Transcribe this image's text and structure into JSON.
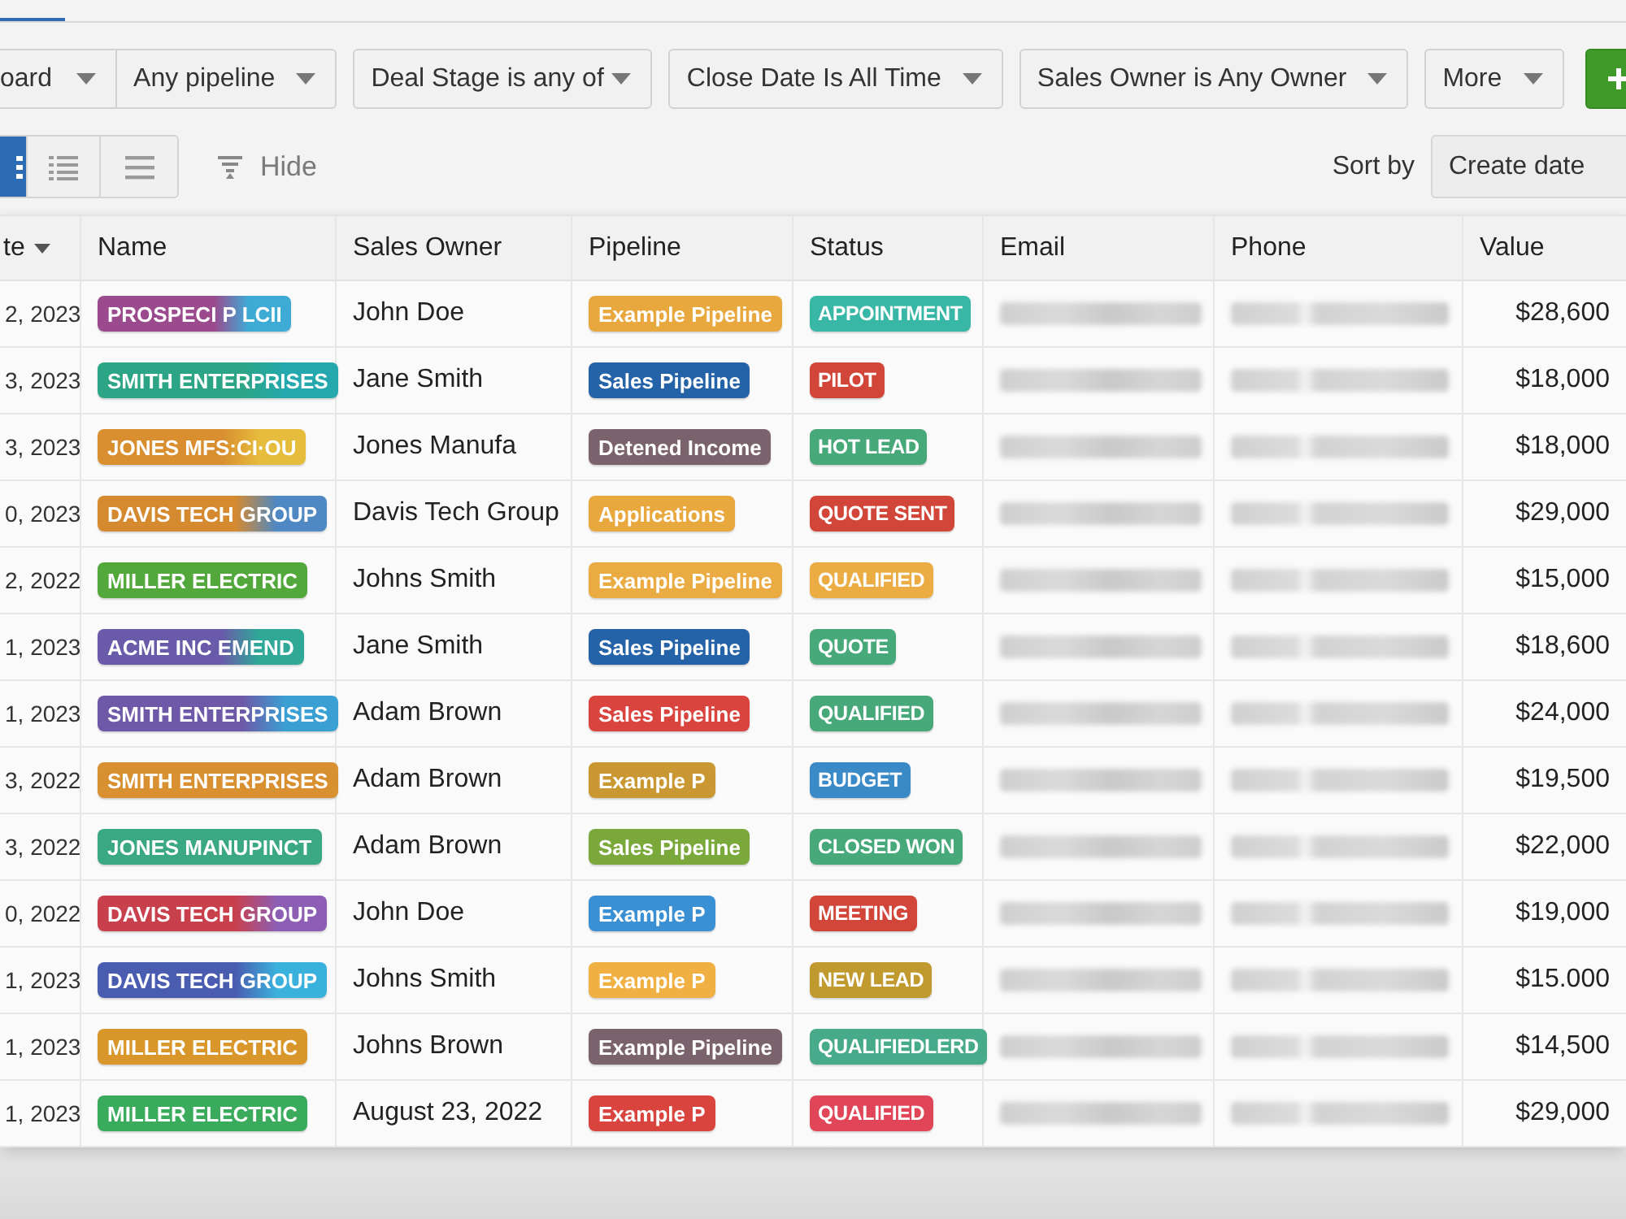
{
  "filters": [
    {
      "segments": [
        "oard",
        "Any pipeline"
      ]
    },
    {
      "segments": [
        "Deal Stage is any of"
      ]
    },
    {
      "segments": [
        "Close Date Is All Time"
      ]
    },
    {
      "segments": [
        "Sales Owner is Any Owner"
      ]
    },
    {
      "segments": [
        "More"
      ]
    }
  ],
  "view_modes": [
    {
      "kind": "grid",
      "selected": true
    },
    {
      "kind": "list",
      "selected": false
    },
    {
      "kind": "lines",
      "selected": false
    }
  ],
  "hide": {
    "label": "Hide"
  },
  "sort": {
    "label": "Sort by",
    "value": "Create date"
  },
  "table": {
    "columns": [
      {
        "label": "te",
        "sorted": true
      },
      {
        "label": "Name",
        "sorted": false
      },
      {
        "label": "Sales Owner",
        "sorted": false
      },
      {
        "label": "Pipeline",
        "sorted": false
      },
      {
        "label": "Status",
        "sorted": false
      },
      {
        "label": "Email",
        "sorted": false
      },
      {
        "label": "Phone",
        "sorted": false
      },
      {
        "label": "Value",
        "sorted": false
      }
    ],
    "rows": [
      {
        "date": "2, 2023",
        "name": {
          "text": "PROSPECI P LCII",
          "color": "#9b4a8e",
          "accent": {
            "color": "#3eaad6"
          }
        },
        "owner": "John Doe",
        "pipeline": {
          "text": "Example Pipeline",
          "color": "#e8a83e"
        },
        "status": {
          "text": "APPOINTMENT",
          "color": "#39b7a6"
        },
        "value": "$28,600"
      },
      {
        "date": "3, 2023",
        "name": {
          "text": "SMITH ENTERPRISES",
          "color": "#2ba585",
          "accent": {
            "color": "#25a8ad"
          }
        },
        "owner": "Jane Smith",
        "pipeline": {
          "text": "Sales Pipeline",
          "color": "#2563a8"
        },
        "status": {
          "text": "PILOT",
          "color": "#d2463a"
        },
        "value": "$18,000"
      },
      {
        "date": "3, 2023",
        "name": {
          "text": "JONES MFS:CI·OU",
          "color": "#d98f2f",
          "accent": {
            "color": "#e6bc3c"
          }
        },
        "owner": "Jones Manufa",
        "pipeline": {
          "text": "Detened Income",
          "color": "#7a636d"
        },
        "status": {
          "text": "HOT LEAD",
          "color": "#47a97a"
        },
        "value": "$18,000"
      },
      {
        "date": "0, 2023",
        "name": {
          "text": "DAVIS TECH GROUP",
          "color": "#d68a30",
          "accent": {
            "color": "#4f88c2"
          }
        },
        "owner": "Davis Tech Group",
        "pipeline": {
          "text": "Applications",
          "color": "#e8a83e"
        },
        "status": {
          "text": "QUOTE SENT",
          "color": "#d2463a"
        },
        "value": "$29,000"
      },
      {
        "date": "2, 2022",
        "name": {
          "text": "MILLER ELECTRIC",
          "color": "#52a83a"
        },
        "owner": "Johns Smith",
        "pipeline": {
          "text": "Example Pipeline",
          "color": "#e9ab42"
        },
        "status": {
          "text": "QUALIFIED",
          "color": "#ebad43"
        },
        "value": "$15,000"
      },
      {
        "date": "1, 2023",
        "name": {
          "text": "ACME INC EMEND",
          "color": "#6a5aaa",
          "accent": {
            "color": "#2fa898"
          }
        },
        "owner": "Jane Smith",
        "pipeline": {
          "text": "Sales Pipeline",
          "color": "#2563a8"
        },
        "status": {
          "text": "QUOTE",
          "color": "#47a97a"
        },
        "value": "$18,600"
      },
      {
        "date": "1, 2023",
        "name": {
          "text": "SMITH ENTERPRISES",
          "color": "#6e58a8",
          "accent": {
            "color": "#3a9fd2"
          }
        },
        "owner": "Adam Brown",
        "pipeline": {
          "text": "Sales Pipeline",
          "color": "#d9443f"
        },
        "status": {
          "text": "QUALIFIED",
          "color": "#47a97a"
        },
        "value": "$24,000"
      },
      {
        "date": "3, 2022",
        "name": {
          "text": "SMITH ENTERPRISES",
          "color": "#d99030"
        },
        "owner": "Adam Brown",
        "pipeline": {
          "text": "Example P",
          "color": "#c99832"
        },
        "status": {
          "text": "BUDGET",
          "color": "#3a8ac8"
        },
        "value": "$19,500"
      },
      {
        "date": "3, 2022",
        "name": {
          "text": "JONES MANUPINCT",
          "color": "#3aa882"
        },
        "owner": "Adam Brown",
        "pipeline": {
          "text": "Sales Pipeline",
          "color": "#7aa83a"
        },
        "status": {
          "text": "CLOSED WON",
          "color": "#47a97a"
        },
        "value": "$22,000"
      },
      {
        "date": "0, 2022",
        "name": {
          "text": "DAVIS TECH GROUP",
          "color": "#c9404d",
          "accent": {
            "color": "#8d5fb4"
          }
        },
        "owner": "John Doe",
        "pipeline": {
          "text": "Example P",
          "color": "#3b8fd3"
        },
        "status": {
          "text": "MEETING",
          "color": "#d2463a"
        },
        "value": "$19,000"
      },
      {
        "date": "1, 2023",
        "name": {
          "text": "DAVIS TECH GROUP",
          "color": "#4a5cb0",
          "accent": {
            "color": "#3ab0dc"
          }
        },
        "owner": "Johns Smith",
        "pipeline": {
          "text": "Example P",
          "color": "#f0b043"
        },
        "status": {
          "text": "NEW LEAD",
          "color": "#c0992f"
        },
        "value": "$15.000"
      },
      {
        "date": "1, 2023",
        "name": {
          "text": "MILLER ELECTRIC",
          "color": "#d9962a"
        },
        "owner": "Johns Brown",
        "pipeline": {
          "text": "Example Pipeline",
          "color": "#7a636d"
        },
        "status": {
          "text": "QUALIFIEDLERD",
          "color": "#47aa8a"
        },
        "value": "$14,500"
      },
      {
        "date": "1, 2023",
        "name": {
          "text": "MILLER ELECTRIC",
          "color": "#3aaa5c"
        },
        "owner": "August 23, 2022",
        "pipeline": {
          "text": "Example P",
          "color": "#d9443f"
        },
        "status": {
          "text": "QUALIFIED",
          "color": "#e04657"
        },
        "value": "$29,000"
      }
    ]
  }
}
